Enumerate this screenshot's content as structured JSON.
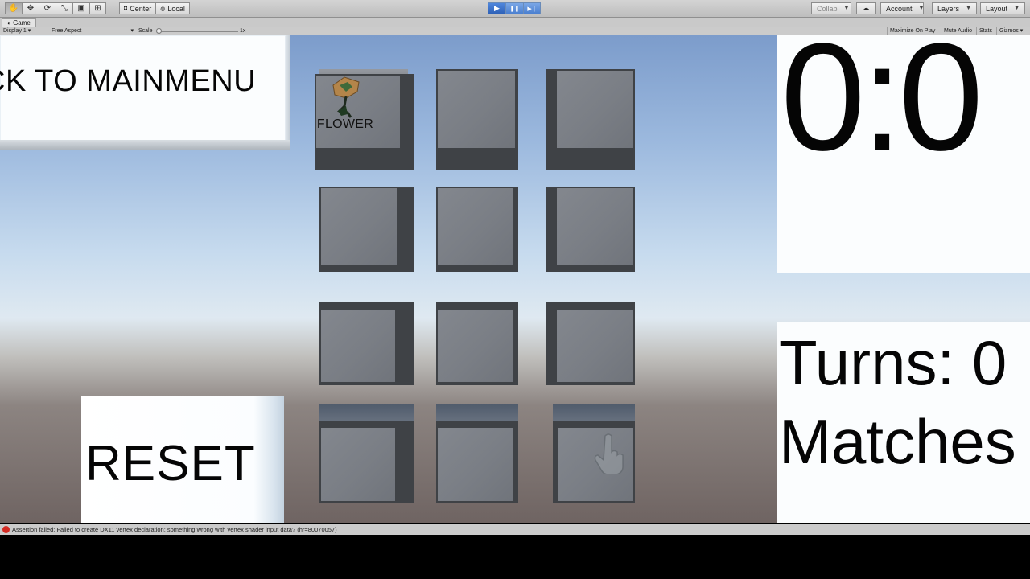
{
  "toolbar": {
    "transform_tools": [
      {
        "icon": "hand-icon",
        "glyph": "✋"
      },
      {
        "icon": "move-icon",
        "glyph": "✥"
      },
      {
        "icon": "rotate-icon",
        "glyph": "⟳"
      },
      {
        "icon": "scale-icon",
        "glyph": "⤡"
      },
      {
        "icon": "rect-icon",
        "glyph": "▣"
      },
      {
        "icon": "transform-icon",
        "glyph": "⊞"
      }
    ],
    "pivot_label": "Center",
    "space_label": "Local",
    "play_icons": {
      "play": "▶",
      "pause": "❚❚",
      "step": "▶❙"
    },
    "collab_label": "Collab",
    "cloud_icon": "☁",
    "account_label": "Account",
    "layers_label": "Layers",
    "layout_label": "Layout"
  },
  "game_view": {
    "tab_label": "Game",
    "display_label": "Display 1",
    "aspect_label": "Free Aspect",
    "scale_label": "Scale",
    "scale_value": "1x",
    "maximize_label": "Maximize On Play",
    "mute_label": "Mute Audio",
    "stats_label": "Stats",
    "gizmos_label": "Gizmos"
  },
  "scene": {
    "back_button_label": "CK TO MAINMENU",
    "reset_button_label": "RESET",
    "timer_text": "0:0",
    "turns_text": "Turns: 0",
    "matches_text": "Matches",
    "revealed_card_label": "FLOWER",
    "card_count": 12
  },
  "console": {
    "error_message": "Assertion failed: Failed to create DX11 vertex declaration; something wrong with vertex shader input data? (hr=80070057)"
  },
  "colors": {
    "sky_top": "#7c9ccb",
    "horizon": "#dfe9f1",
    "ground": "#6f6462",
    "card_face": "#7d8188",
    "panel_white": "#fbfdfe",
    "play_blue": "#4b7fd0",
    "error_red": "#d32a22"
  }
}
